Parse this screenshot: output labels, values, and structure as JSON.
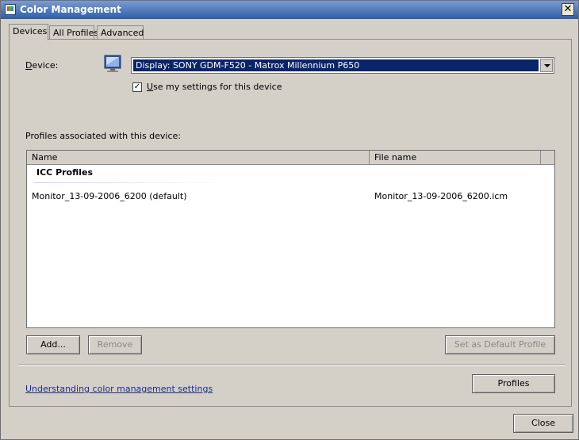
{
  "window": {
    "title": "Color Management",
    "close_glyph": "✕"
  },
  "tabs": [
    {
      "label": "Devices",
      "active": true
    },
    {
      "label": "All Profiles",
      "active": false
    },
    {
      "label": "Advanced",
      "active": false
    }
  ],
  "device": {
    "label_key": "D",
    "label_rest": "evice:",
    "selected": "Display: SONY GDM-F520 - Matrox Millennium P650",
    "icon": "monitor-icon"
  },
  "use_my_settings": {
    "checked": true,
    "check_glyph": "✓",
    "label_key": "U",
    "label_rest": "se my settings for this device"
  },
  "profiles_label": "Profiles associated with this device:",
  "list": {
    "columns": [
      "Name",
      "File name"
    ],
    "group": "ICC Profiles",
    "rows": [
      {
        "name": "Monitor_13-09-2006_6200 (default)",
        "file": "Monitor_13-09-2006_6200.icm"
      }
    ]
  },
  "buttons": {
    "add": "Add...",
    "remove": "Remove",
    "set_default": "Set as Default Profile",
    "profiles": "Profiles",
    "close": "Close"
  },
  "help_link": "Understanding color management settings",
  "colors": {
    "titlebar_start": "#7a9bd0",
    "titlebar_end": "#2d5da8",
    "selection": "#0a246a",
    "link": "#1b2c8e"
  }
}
